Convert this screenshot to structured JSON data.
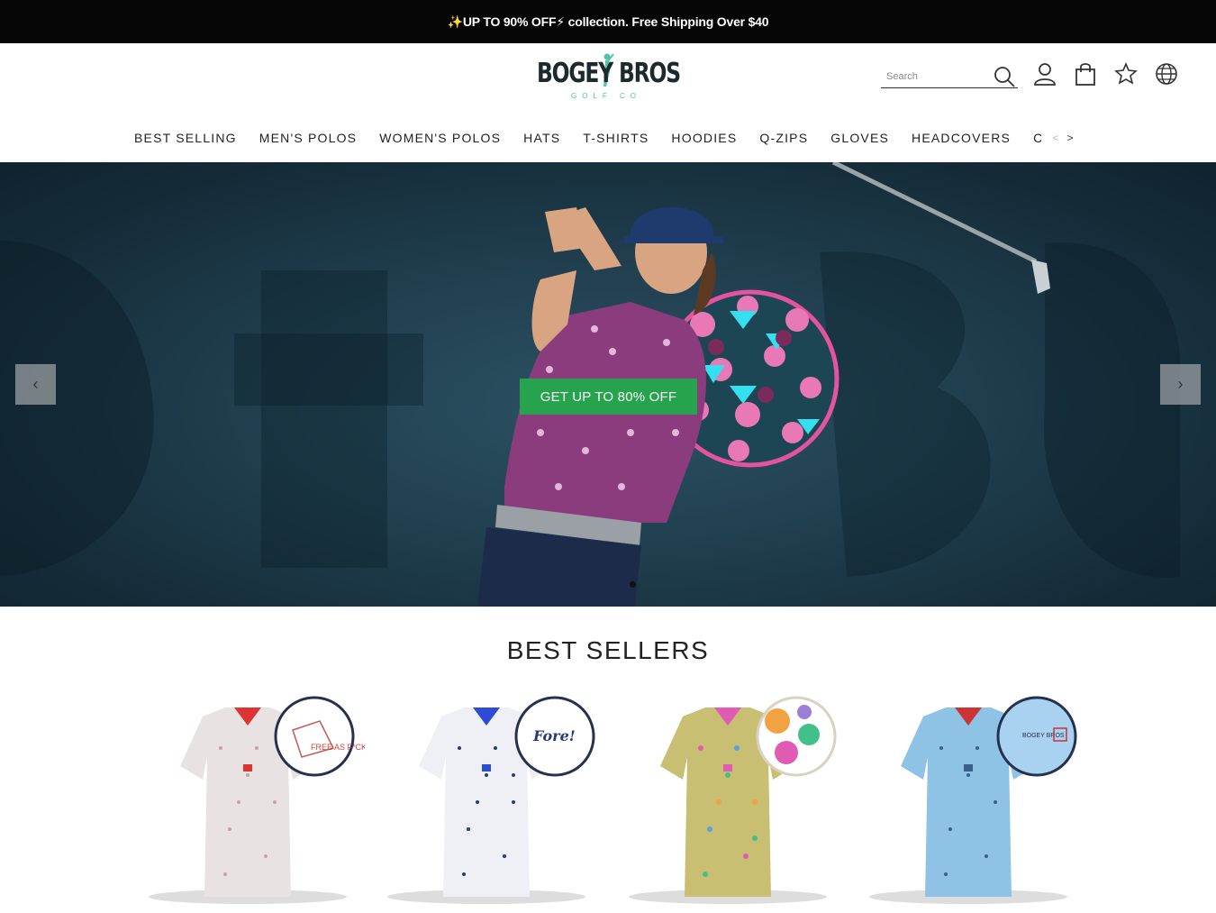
{
  "announcement": {
    "text": "✨UP TO 90% OFF⚡ collection.  Free Shipping Over $40"
  },
  "header": {
    "logo": {
      "brand": "BOGEY BROS",
      "sub": "GOLF CO"
    },
    "search": {
      "placeholder": "Search",
      "value": ""
    },
    "icons": [
      "search-icon",
      "account-icon",
      "cart-icon",
      "rewards-icon",
      "globe-icon"
    ]
  },
  "nav": {
    "items": [
      {
        "label": "BEST SELLING"
      },
      {
        "label": "MEN'S POLOS"
      },
      {
        "label": "WOMEN'S POLOS"
      },
      {
        "label": "HATS"
      },
      {
        "label": "T-SHIRTS"
      },
      {
        "label": "HOODIES"
      },
      {
        "label": "Q-ZIPS"
      },
      {
        "label": "GLOVES"
      },
      {
        "label": "HEADCOVERS"
      },
      {
        "label": "CAN SLEEVES"
      }
    ],
    "prev_label": "<",
    "next_label": ">"
  },
  "hero": {
    "cta_label": "GET UP TO 80% OFF",
    "prev_label": "‹",
    "next_label": "›"
  },
  "best_sellers": {
    "title": "BEST SELLERS",
    "badge_texts": [
      "FREE AS F*CK",
      "Fore!",
      "BOGEY BROS"
    ]
  },
  "colors": {
    "announcement_bg": "#050505",
    "cta_green": "#26a34c",
    "brand_teal": "#4fc4a6",
    "hero_bg": "#1f3d4d"
  }
}
